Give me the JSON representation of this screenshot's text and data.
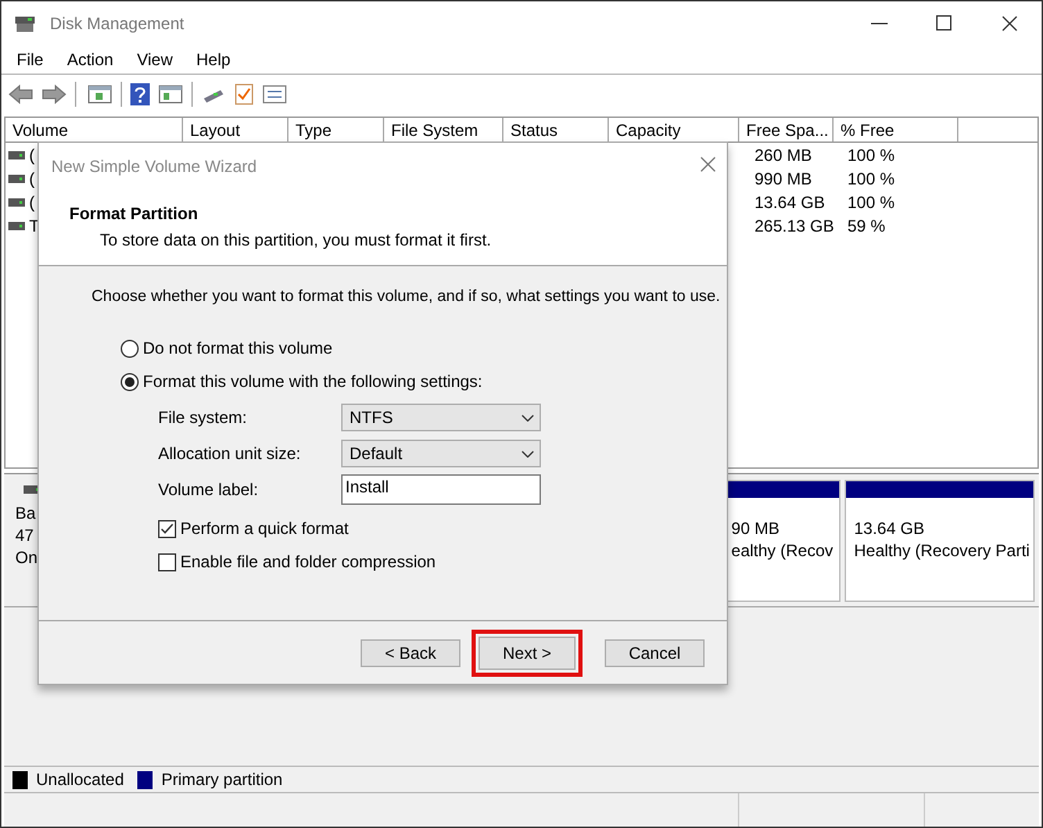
{
  "window": {
    "title": "Disk Management"
  },
  "menu": [
    "File",
    "Action",
    "View",
    "Help"
  ],
  "volume_table": {
    "columns": [
      "Volume",
      "Layout",
      "Type",
      "File System",
      "Status",
      "Capacity",
      "Free Spa...",
      "% Free"
    ],
    "rows": [
      {
        "volume": "(",
        "free_space": "260 MB",
        "percent_free": "100 %"
      },
      {
        "volume": "(",
        "free_space": "990 MB",
        "percent_free": "100 %"
      },
      {
        "volume": "(",
        "free_space": "13.64 GB",
        "percent_free": "100 %"
      },
      {
        "volume": "T",
        "free_space": "265.13 GB",
        "percent_free": "59 %"
      }
    ]
  },
  "disk_map": {
    "disk_lines": [
      "Ba",
      "47",
      "On"
    ],
    "partitions": [
      {
        "size": "90 MB",
        "status": "ealthy (Recov",
        "color": "#000080"
      },
      {
        "size": "13.64 GB",
        "status": "Healthy (Recovery Parti",
        "color": "#000080"
      }
    ]
  },
  "legend": [
    {
      "label": "Unallocated",
      "color": "#000000"
    },
    {
      "label": "Primary partition",
      "color": "#000080"
    }
  ],
  "dialog": {
    "title": "New Simple Volume Wizard",
    "heading": "Format Partition",
    "subheading": "To store data on this partition, you must format it first.",
    "instruction": "Choose whether you want to format this volume, and if so, what settings you want to use.",
    "options": [
      {
        "label": "Do not format this volume",
        "selected": false
      },
      {
        "label": "Format this volume with the following settings:",
        "selected": true
      }
    ],
    "settings": [
      {
        "kind": "dropdown",
        "label": "File system:",
        "value": "NTFS"
      },
      {
        "kind": "dropdown",
        "label": "Allocation unit size:",
        "value": "Default"
      },
      {
        "kind": "text",
        "label": "Volume label:",
        "value": "Install"
      }
    ],
    "checkboxes": [
      {
        "label": "Perform a quick format",
        "checked": true
      },
      {
        "label": "Enable file and folder compression",
        "checked": false
      }
    ],
    "buttons": [
      {
        "label": "< Back",
        "highlighted": false
      },
      {
        "label": "Next >",
        "highlighted": true
      },
      {
        "label": "Cancel",
        "highlighted": false
      }
    ]
  }
}
